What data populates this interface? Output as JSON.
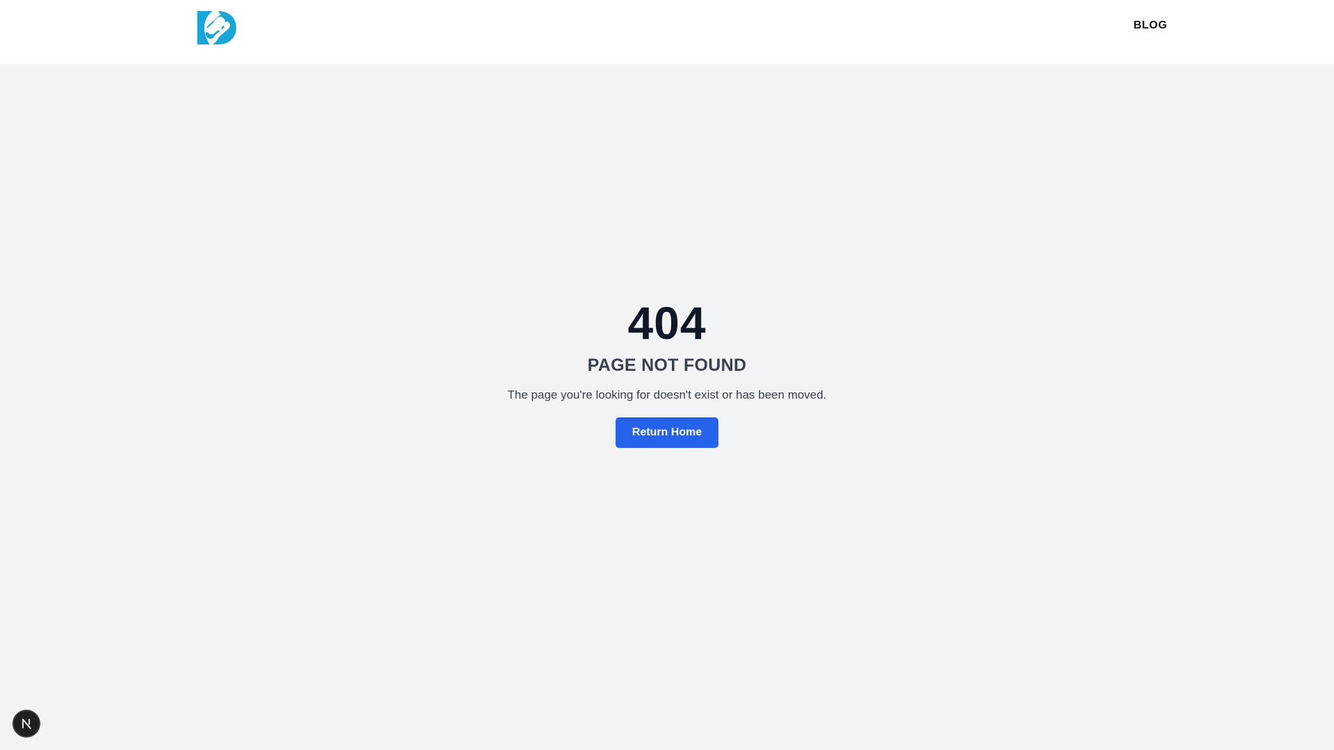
{
  "header": {
    "logo_icon": "brand-logo-icon",
    "brand_color": "#19a7d9",
    "nav": {
      "blog_label": "BLOG"
    }
  },
  "error": {
    "code": "404",
    "title": "PAGE NOT FOUND",
    "description": "The page you're looking for doesn't exist or has been moved.",
    "button_label": "Return Home",
    "button_color": "#2563eb"
  },
  "dev_badge": {
    "icon": "nextjs-icon",
    "letter": "N"
  }
}
